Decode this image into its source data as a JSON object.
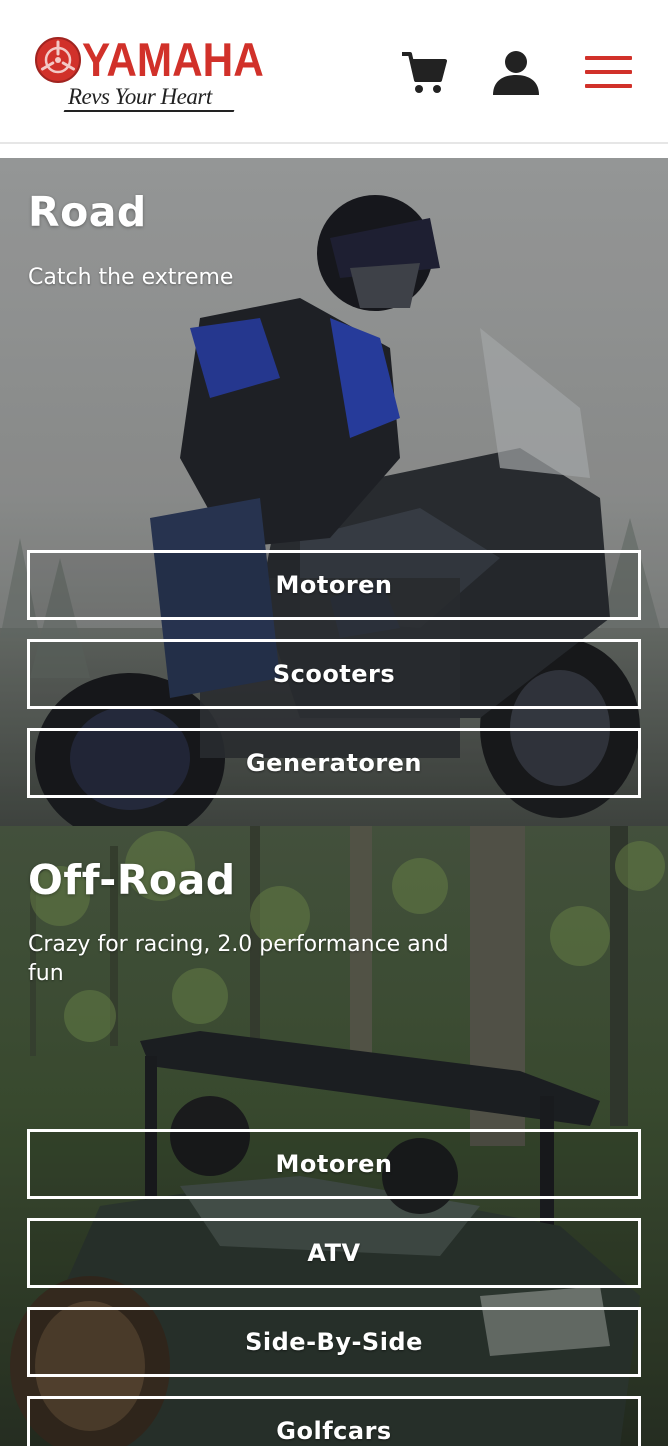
{
  "header": {
    "brand": "YAMAHA",
    "tagline": "Revs Your Heart",
    "icons": [
      "cart-icon",
      "user-icon",
      "hamburger-menu-icon"
    ],
    "brand_color": "#d1312a"
  },
  "sections": [
    {
      "title": "Road",
      "subtitle": "Catch the extreme",
      "buttons": [
        "Motoren",
        "Scooters",
        "Generatoren"
      ]
    },
    {
      "title": "Off-Road",
      "subtitle": "Crazy for racing, 2.0 performance and fun",
      "buttons": [
        "Motoren",
        "ATV",
        "Side-By-Side",
        "Golfcars"
      ]
    }
  ]
}
